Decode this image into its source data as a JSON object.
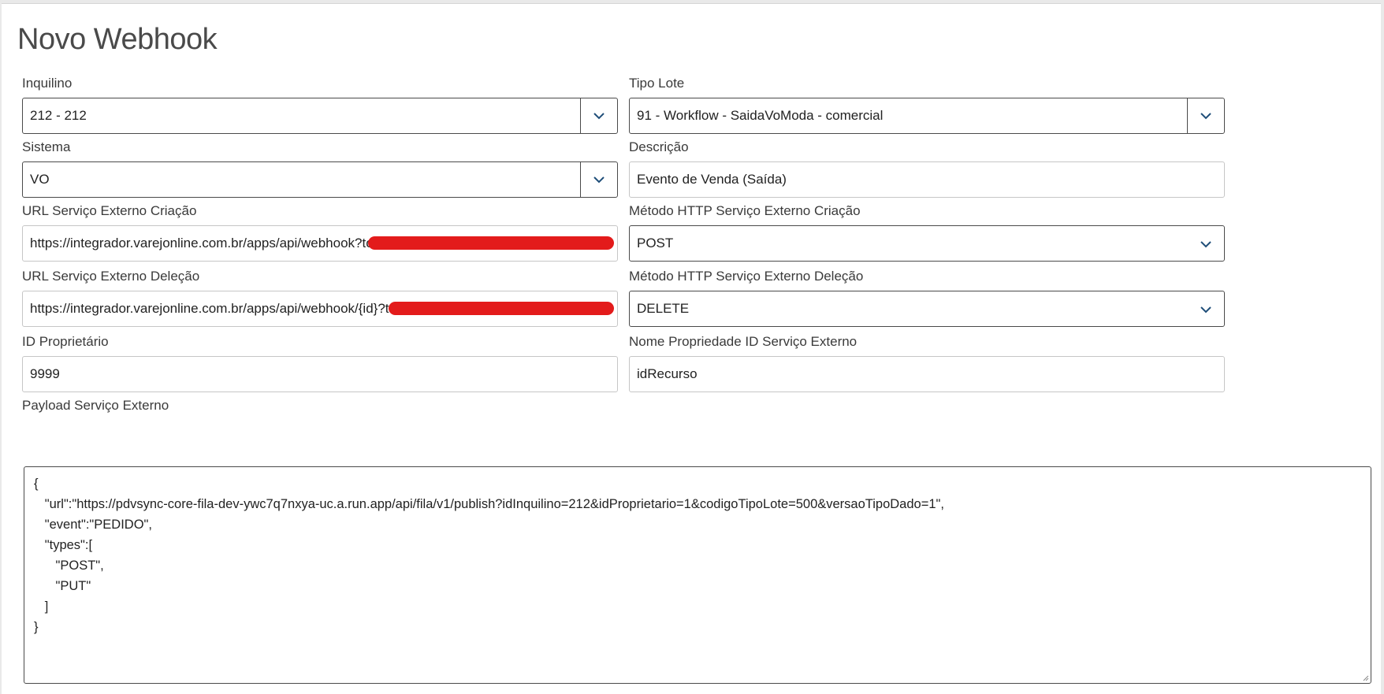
{
  "page": {
    "title": "Novo Webhook"
  },
  "form": {
    "inquilino": {
      "label": "Inquilino",
      "value": "212 - 212"
    },
    "tipo_lote": {
      "label": "Tipo Lote",
      "value": "91 - Workflow - SaidaVoModa - comercial"
    },
    "sistema": {
      "label": "Sistema",
      "value": "VO"
    },
    "descricao": {
      "label": "Descrição",
      "value": "Evento de Venda (Saída)"
    },
    "url_criacao": {
      "label": "URL Serviço Externo Criação",
      "value": "https://integrador.varejonline.com.br/apps/api/webhook?token="
    },
    "metodo_criacao": {
      "label": "Método HTTP Serviço Externo Criação",
      "value": "POST"
    },
    "url_delecao": {
      "label": "URL Serviço Externo Deleção",
      "value": "https://integrador.varejonline.com.br/apps/api/webhook/{id}?token="
    },
    "metodo_delecao": {
      "label": "Método HTTP Serviço Externo Deleção",
      "value": "DELETE"
    },
    "id_proprietario": {
      "label": "ID Proprietário",
      "value": "9999"
    },
    "nome_propriedade": {
      "label": "Nome Propriedade ID Serviço Externo",
      "value": "idRecurso"
    },
    "payload": {
      "label": "Payload Serviço Externo",
      "value": "{\n   \"url\":\"https://pdvsync-core-fila-dev-ywc7q7nxya-uc.a.run.app/api/fila/v1/publish?idInquilino=212&idProprietario=1&codigoTipoLote=500&versaoTipoDado=1\",\n   \"event\":\"PEDIDO\",\n   \"types\":[\n      \"POST\",\n      \"PUT\"\n   ]\n}"
    }
  },
  "icons": {
    "dropdown": "chevron-down-icon",
    "resize": "resize-handle-icon"
  },
  "colors": {
    "chevron": "#1f4e79",
    "redaction": "#e31b1b",
    "border_dark": "#4a4a4a",
    "border_light": "#c6c6c6"
  }
}
